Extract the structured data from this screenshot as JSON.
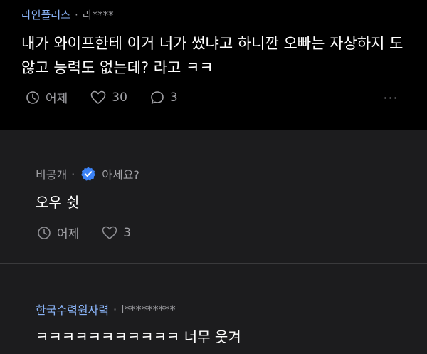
{
  "post": {
    "company": "라인플러스",
    "separator": "·",
    "author_masked": "라****",
    "content": "내가 와이프한테 이거 너가 썼냐고 하니깐 오빠는 자상하지 도 않고 능력도 없는데? 라고 ㅋㅋ",
    "time": "어제",
    "likes": "30",
    "comments": "3",
    "more_label": "···"
  },
  "reply1": {
    "company": "비공개",
    "separator": "·",
    "author": "아세요?",
    "content": "오우 쉿",
    "time": "어제",
    "likes": "3"
  },
  "reply2": {
    "company": "한국수력원자력",
    "separator": "·",
    "author_masked": "l*********",
    "content": "ㅋㅋㅋㅋㅋㅋㅋㅋㅋㅋㅋ 너무 웃겨"
  },
  "colors": {
    "company_link": "#8ab4f8",
    "verified_badge": "#3b82f6",
    "post_background": "#000000",
    "reply_background": "#1c1c1e"
  }
}
